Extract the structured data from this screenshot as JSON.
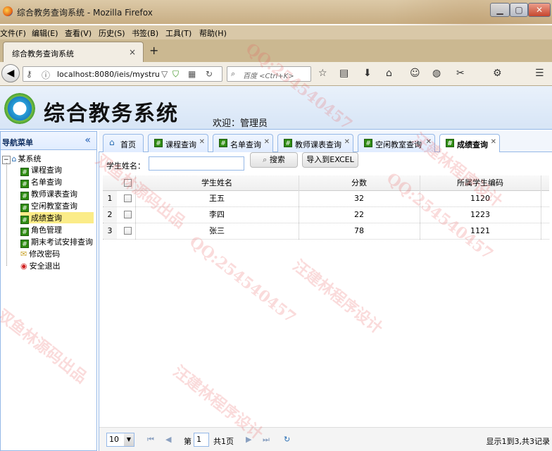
{
  "window": {
    "title": "综合教务查询系统 - Mozilla Firefox",
    "buttons": [
      "▁",
      "▢",
      "✕"
    ]
  },
  "menu": [
    "文件(F)",
    "编辑(E)",
    "查看(V)",
    "历史(S)",
    "书签(B)",
    "工具(T)",
    "帮助(H)"
  ],
  "browser_tab": {
    "label": "综合教务查询系统",
    "close": "×",
    "new": "+"
  },
  "nav": {
    "url": "localhost:8080/ieis/mystru",
    "search_placeholder": "百度 <Ctrl+K>"
  },
  "app": {
    "title": "综合教务系统",
    "welcome": "欢迎：管理员"
  },
  "sidebar": {
    "title": "导航菜单",
    "collapse": "«",
    "root": "某系统",
    "items": [
      "课程查询",
      "名单查询",
      "教师课表查询",
      "空闲教室查询",
      "成绩查询",
      "角色管理",
      "期末考试安排查询",
      "修改密码",
      "安全退出"
    ]
  },
  "tabs": [
    {
      "label": "首页"
    },
    {
      "label": "课程查询"
    },
    {
      "label": "名单查询"
    },
    {
      "label": "教师课表查询"
    },
    {
      "label": "空闲教室查询"
    },
    {
      "label": "成绩查询"
    }
  ],
  "toolbar": {
    "name_label": "学生姓名：",
    "search_button": "搜索",
    "export_button": "导入到EXCEL"
  },
  "table": {
    "columns": [
      "学生姓名",
      "分数",
      "所属学生编码"
    ],
    "rows": [
      {
        "num": "1",
        "name": "王五",
        "score": "32",
        "code": "1120"
      },
      {
        "num": "2",
        "name": "李四",
        "score": "22",
        "code": "1223"
      },
      {
        "num": "3",
        "name": "张三",
        "score": "78",
        "code": "1121"
      }
    ]
  },
  "pager": {
    "page_size": "10",
    "page_prefix": "第",
    "page_value": "1",
    "page_suffix": "共1页",
    "summary": "显示1到3,共3记录"
  },
  "watermark": {
    "texts": [
      "QQ:254540457",
      "汪建林程序设计",
      "双鱼林源码出品"
    ]
  }
}
